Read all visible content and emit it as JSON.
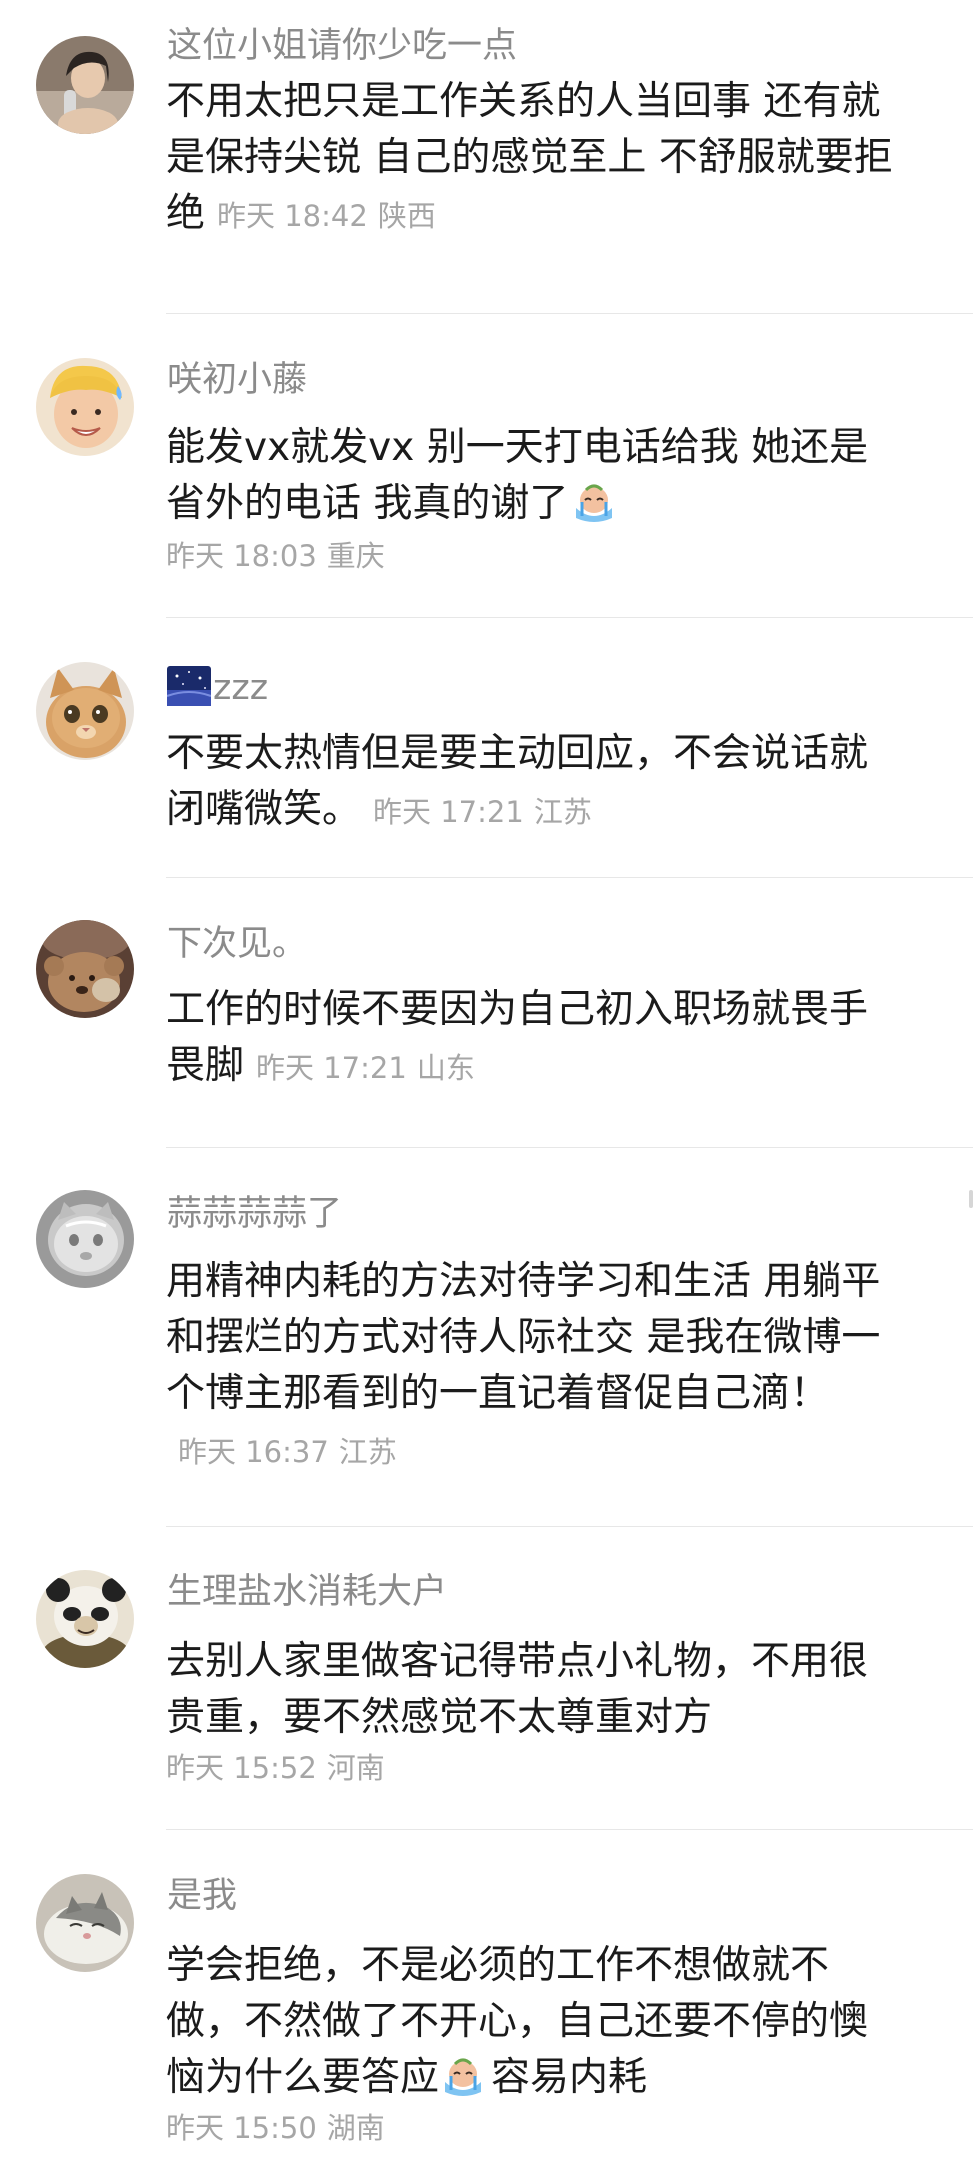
{
  "comments": [
    {
      "username": "这位小姐请你少吃一点",
      "body": "不用太把只是工作关系的人当回事 还有就是保持尖锐 自己的感觉至上 不舒服就要拒绝",
      "time": "昨天 18:42",
      "location": "陕西",
      "avatar_icon": "user-photo-avatar"
    },
    {
      "username": "咲初小藤",
      "body": "能发vx就发vx 别一天打电话给我 她还是省外的电话 我真的谢了",
      "emoji": "crying-face-emoji",
      "time": "昨天 18:03",
      "location": "重庆",
      "avatar_icon": "smiling-face-avatar"
    },
    {
      "username": "zzz",
      "username_badge": "starry-night-badge",
      "body": "不要太热情但是要主动回应，不会说话就闭嘴微笑。",
      "time": "昨天 17:21",
      "location": "江苏",
      "avatar_icon": "cat-avatar"
    },
    {
      "username": "下次见。",
      "body": "工作的时候不要因为自己初入职场就畏手畏脚",
      "time": "昨天 17:21",
      "location": "山东",
      "avatar_icon": "teddy-bear-avatar"
    },
    {
      "username": "蒜蒜蒜蒜了",
      "body": "用精神内耗的方法对待学习和生活 用躺平和摆烂的方式对待人际社交 是我在微博一个博主那看到的一直记着督促自己滴！",
      "time": "昨天 16:37",
      "location": "江苏",
      "avatar_icon": "glass-cat-avatar"
    },
    {
      "username": "生理盐水消耗大户",
      "body": "去别人家里做客记得带点小礼物，不用很贵重，要不然感觉不太尊重对方",
      "time": "昨天 15:52",
      "location": "河南",
      "avatar_icon": "panda-meme-avatar"
    },
    {
      "username": "是我",
      "body_part1": "学会拒绝，不是必须的工作不想做就不做，不然做了不开心，自己还要不停的懊恼为什么要答应",
      "emoji": "crying-face-emoji",
      "body_part2": "容易内耗",
      "time": "昨天 15:50",
      "location": "湖南",
      "avatar_icon": "sleeping-cat-avatar"
    }
  ],
  "colors": {
    "username": "#8b8b8b",
    "body": "#1b1b1b",
    "meta": "#a6a6a6",
    "divider": "#e7e7e7"
  }
}
